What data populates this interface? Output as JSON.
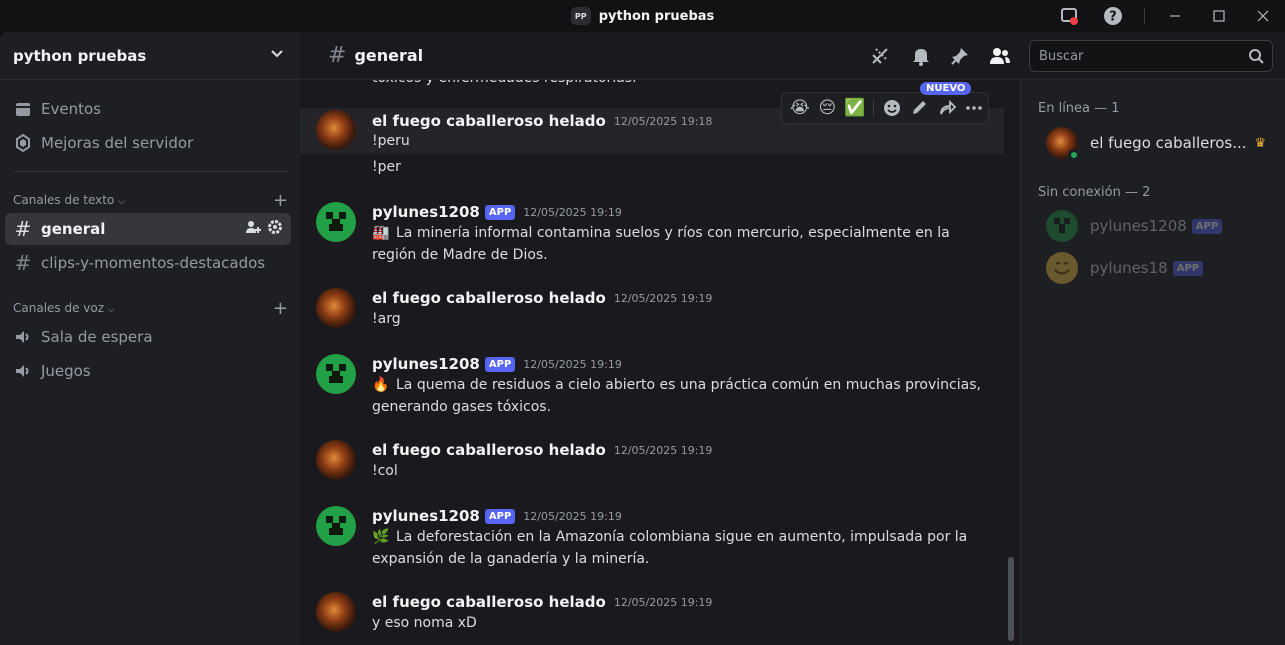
{
  "window": {
    "app_badge": "PP",
    "title": "python pruebas"
  },
  "sidebar": {
    "server_name": "python pruebas",
    "items": [
      {
        "label": "Eventos",
        "icon": "calendar-icon"
      },
      {
        "label": "Mejoras del servidor",
        "icon": "boost-icon"
      }
    ],
    "text_category": "Canales de texto",
    "text_channels": [
      {
        "label": "general",
        "active": true
      },
      {
        "label": "clips-y-momentos-destacados",
        "active": false
      }
    ],
    "voice_category": "Canales de voz",
    "voice_channels": [
      {
        "label": "Sala de espera"
      },
      {
        "label": "Juegos"
      }
    ]
  },
  "header": {
    "channel": "general",
    "search_placeholder": "Buscar"
  },
  "chat": {
    "cutoff_text": "tóxicos y enfermedades respiratorias.",
    "toolbar_badge": "NUEVO",
    "toolbar_reactions": [
      "😭",
      "😔",
      "✅"
    ],
    "messages": [
      {
        "author": "el fuego caballeroso helado",
        "time": "12/05/2025 19:18",
        "lines": [
          "!peru",
          "!per"
        ],
        "app": false
      },
      {
        "author": "pylunes1208",
        "badge": "APP",
        "time": "12/05/2025 19:19",
        "emoji": "🏭",
        "text": "La minería informal contamina suelos y ríos con mercurio, especialmente en la región de Madre de Dios."
      },
      {
        "author": "el fuego caballeroso helado",
        "time": "12/05/2025 19:19",
        "text": "!arg"
      },
      {
        "author": "pylunes1208",
        "badge": "APP",
        "time": "12/05/2025 19:19",
        "emoji": "🔥",
        "text": "La quema de residuos a cielo abierto es una práctica común en muchas provincias, generando gases tóxicos."
      },
      {
        "author": "el fuego caballeroso helado",
        "time": "12/05/2025 19:19",
        "text": "!col"
      },
      {
        "author": "pylunes1208",
        "badge": "APP",
        "time": "12/05/2025 19:19",
        "emoji": "🌿",
        "text": "La deforestación en la Amazonía colombiana sigue en aumento, impulsada por la expansión de la ganadería y la minería."
      },
      {
        "author": "el fuego caballeroso helado",
        "time": "12/05/2025 19:19",
        "text": "y eso noma xD"
      }
    ]
  },
  "members": {
    "online_label": "En línea — 1",
    "offline_label": "Sin conexión — 2",
    "online": [
      {
        "name": "el fuego caballeros..."
      }
    ],
    "offline": [
      {
        "name": "pylunes1208",
        "badge": "APP"
      },
      {
        "name": "pylunes18",
        "badge": "APP"
      }
    ]
  },
  "colors": {
    "accent": "#5865f2",
    "online": "#23a55a",
    "crown": "#f0b232"
  }
}
